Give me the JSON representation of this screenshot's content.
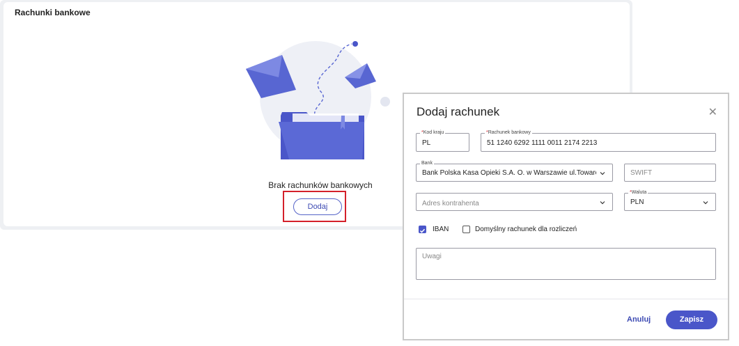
{
  "panel": {
    "title": "Rachunki bankowe",
    "empty_text": "Brak rachunków bankowych",
    "add_button": "Dodaj"
  },
  "modal": {
    "title": "Dodaj rachunek",
    "close_icon": "close-icon",
    "fields": {
      "kod_kraju": {
        "label": "Kod kraju",
        "value": "PL"
      },
      "rachunek": {
        "label": "Rachunek bankowy",
        "value": "51 1240 6292 1111 0011 2174 2213"
      },
      "bank": {
        "label": "Bank",
        "value": "Bank Polska Kasa Opieki S.A. O. w Warszawie ul.Towarow..."
      },
      "swift": {
        "placeholder": "SWIFT"
      },
      "adres": {
        "placeholder": "Adres kontrahenta"
      },
      "waluta": {
        "label": "Waluta",
        "value": "PLN"
      },
      "uwagi": {
        "placeholder": "Uwagi"
      }
    },
    "checkboxes": {
      "iban": {
        "label": "IBAN",
        "checked": true
      },
      "domyslny": {
        "label": "Domyślny rachunek dla rozliczeń",
        "checked": false
      }
    },
    "cancel": "Anuluj",
    "save": "Zapisz"
  },
  "colors": {
    "accent": "#4a56c9",
    "highlight": "#d4202a"
  }
}
